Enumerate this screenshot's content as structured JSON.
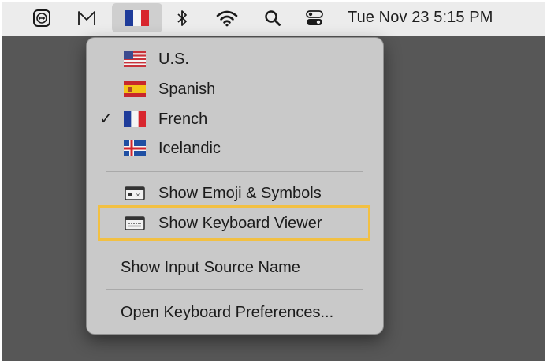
{
  "menubar": {
    "icons": [
      {
        "name": "teamviewer-icon"
      },
      {
        "name": "gmail-icon"
      },
      {
        "name": "french-flag-icon"
      },
      {
        "name": "bluetooth-icon"
      },
      {
        "name": "wifi-icon"
      },
      {
        "name": "spotlight-search-icon"
      },
      {
        "name": "control-center-icon"
      }
    ],
    "clock": "Tue Nov 23  5:15 PM"
  },
  "menu": {
    "languages": [
      {
        "label": "U.S.",
        "flag": "us",
        "checked": false
      },
      {
        "label": "Spanish",
        "flag": "es",
        "checked": false
      },
      {
        "label": "French",
        "flag": "fr",
        "checked": true
      },
      {
        "label": "Icelandic",
        "flag": "is",
        "checked": false
      }
    ],
    "check_glyph": "✓",
    "show_emoji": "Show Emoji & Symbols",
    "show_keyboard_viewer": "Show Keyboard Viewer",
    "show_input_source_name": "Show Input Source Name",
    "open_keyboard_prefs": "Open Keyboard Preferences..."
  },
  "colors": {
    "menubar_bg": "#ececec",
    "desktop_bg": "#575757",
    "menu_bg": "#c9c9c9",
    "highlight_border": "#f2c043"
  }
}
